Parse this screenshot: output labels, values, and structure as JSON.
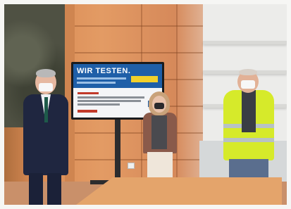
{
  "scene": {
    "tv_screen": {
      "headline": "WIR TESTEN."
    }
  }
}
